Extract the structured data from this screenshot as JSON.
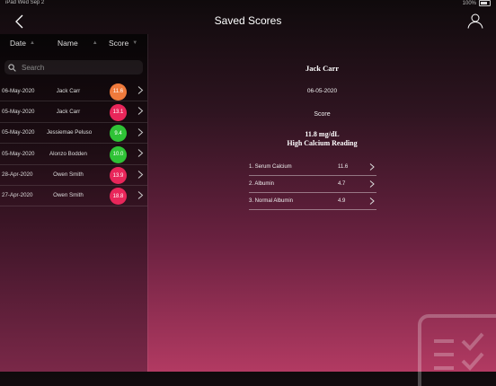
{
  "status": {
    "left": "iPad  Wed Sep 2",
    "battery": "100%"
  },
  "header": {
    "title": "Saved Scores"
  },
  "sort": {
    "date": "Date",
    "name": "Name",
    "score": "Score"
  },
  "search": {
    "placeholder": "Search"
  },
  "list": [
    {
      "date": "06-May-2020",
      "name": "Jack Carr",
      "score": "11.6",
      "color": "#f07a3c"
    },
    {
      "date": "05-May-2020",
      "name": "Jack Carr",
      "score": "13.1",
      "color": "#e8265a"
    },
    {
      "date": "05-May-2020",
      "name": "Jessiemae Peluso",
      "score": "9.4",
      "color": "#2fc236"
    },
    {
      "date": "05-May-2020",
      "name": "Alonzo Bodden",
      "score": "10.0",
      "color": "#2fc236"
    },
    {
      "date": "28-Apr-2020",
      "name": "Owen Smith",
      "score": "13.9",
      "color": "#e8265a"
    },
    {
      "date": "27-Apr-2020",
      "name": "Owen Smith",
      "score": "18.8",
      "color": "#e8265a"
    }
  ],
  "detail": {
    "name": "Jack Carr",
    "date": "06-05-2020",
    "score_label": "Score",
    "value": "11.8 mg/dL",
    "reading": "High Calcium Reading",
    "params": [
      {
        "label": "1. Serum Calcium",
        "value": "11.6"
      },
      {
        "label": "2. Albumin",
        "value": "4.7"
      },
      {
        "label": "3. Normal Albumin",
        "value": "4.9"
      }
    ]
  },
  "icons": {
    "back": "chevron-left-icon",
    "user": "user-icon",
    "search": "search-icon",
    "row": "chevron-right-icon",
    "watermark": "checklist-icon"
  }
}
